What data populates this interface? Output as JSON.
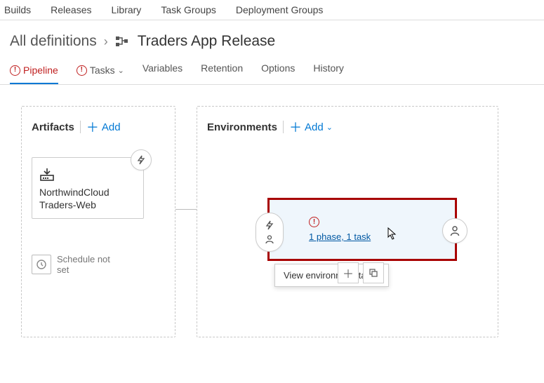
{
  "topnav": {
    "builds": "Builds",
    "releases": "Releases",
    "library": "Library",
    "task_groups": "Task Groups",
    "deployment_groups": "Deployment Groups"
  },
  "breadcrumb": {
    "all_definitions": "All definitions",
    "title": "Traders App Release"
  },
  "subtabs": {
    "pipeline": "Pipeline",
    "tasks": "Tasks",
    "variables": "Variables",
    "retention": "Retention",
    "options": "Options",
    "history": "History"
  },
  "panels": {
    "artifacts": {
      "title": "Artifacts",
      "add": "Add",
      "card_name": "NorthwindCloud Traders-Web",
      "schedule": "Schedule not set"
    },
    "environments": {
      "title": "Environments",
      "add": "Add",
      "link": "1 phase, 1 task",
      "tooltip": "View environment tasks"
    }
  }
}
